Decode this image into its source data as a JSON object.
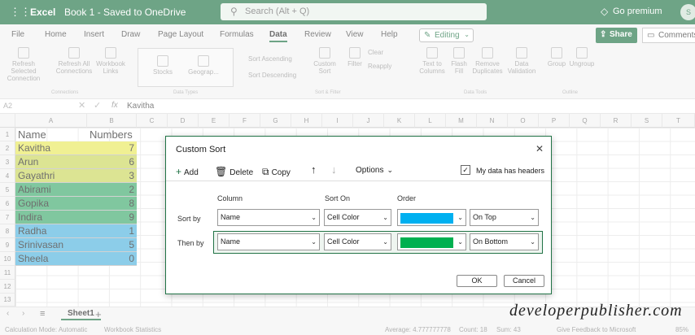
{
  "titlebar": {
    "app": "Excel",
    "book": "Book 1 - Saved to OneDrive",
    "search_placeholder": "Search (Alt + Q)",
    "premium": "Go premium",
    "avatar": "S"
  },
  "tabs": [
    "File",
    "Home",
    "Insert",
    "Draw",
    "Page Layout",
    "Formulas",
    "Data",
    "Review",
    "View",
    "Help"
  ],
  "active_tab": "Data",
  "editing_label": "Editing",
  "share_label": "Share",
  "comments_label": "Comments",
  "ribbon": {
    "buttons": [
      {
        "label": "Refresh Selected Connection"
      },
      {
        "label": "Refresh All Connections"
      },
      {
        "label": "Workbook Links"
      },
      {
        "label": "Stocks"
      },
      {
        "label": "Geograp..."
      },
      {
        "label": "Sort Ascending"
      },
      {
        "label": "Sort Descending"
      },
      {
        "label": "Custom Sort"
      },
      {
        "label": "Filter"
      },
      {
        "label": "Clear"
      },
      {
        "label": "Reapply"
      },
      {
        "label": "Text to Columns"
      },
      {
        "label": "Flash Fill"
      },
      {
        "label": "Remove Duplicates"
      },
      {
        "label": "Data Validation"
      },
      {
        "label": "Group"
      },
      {
        "label": "Ungroup"
      }
    ],
    "groups": [
      "Connections",
      "Data Types",
      "Sort & Filter",
      "Data Tools",
      "Outline"
    ]
  },
  "formula_bar": {
    "ref": "A2",
    "fx": "fx",
    "value": "Kavitha"
  },
  "columns": [
    "A",
    "B",
    "C",
    "D",
    "E",
    "F",
    "G",
    "H",
    "I",
    "J",
    "K",
    "L",
    "M",
    "N",
    "O",
    "P",
    "Q",
    "R",
    "S",
    "T"
  ],
  "rows": [
    "1",
    "2",
    "3",
    "4",
    "5",
    "6",
    "7",
    "8",
    "9",
    "10",
    "11",
    "12",
    "13"
  ],
  "table": {
    "header": [
      "Name",
      "Numbers"
    ],
    "rows": [
      {
        "name": "Kavitha",
        "number": "7",
        "color": "#e8e85a"
      },
      {
        "name": "Arun",
        "number": "6",
        "color": "#c9d65a"
      },
      {
        "name": "Gayathri",
        "number": "3",
        "color": "#c9d65a"
      },
      {
        "name": "Abirami",
        "number": "2",
        "color": "#3daa6c"
      },
      {
        "name": "Gopika",
        "number": "8",
        "color": "#3daa6c"
      },
      {
        "name": "Indira",
        "number": "9",
        "color": "#3daa6c"
      },
      {
        "name": "Radha",
        "number": "1",
        "color": "#4fb3dd"
      },
      {
        "name": "Srinivasan",
        "number": "5",
        "color": "#4fb3dd"
      },
      {
        "name": "Sheela",
        "number": "0",
        "color": "#4fb3dd"
      }
    ]
  },
  "sheet_tab": "Sheet1",
  "status": {
    "calc": "Calculation Mode: Automatic",
    "stats": "Workbook Statistics",
    "average": "Average: 4.777777778",
    "count": "Count: 18",
    "sum": "Sum: 43",
    "feedback": "Give Feedback to Microsoft",
    "zoom": "85%"
  },
  "watermark": "developerpublisher.com",
  "dialog": {
    "title": "Custom Sort",
    "add": "Add",
    "delete": "Delete",
    "copy": "Copy",
    "options": "Options",
    "headers_checkbox": "My data has headers",
    "col_header": "Column",
    "sorton_header": "Sort On",
    "order_header": "Order",
    "sort_by_label": "Sort by",
    "then_by_label": "Then by",
    "row1": {
      "column": "Name",
      "sort_on": "Cell Color",
      "order_color": "#00b0f0",
      "position": "On Top"
    },
    "row2": {
      "column": "Name",
      "sort_on": "Cell Color",
      "order_color": "#00b050",
      "position": "On Bottom"
    },
    "ok": "OK",
    "cancel": "Cancel"
  }
}
